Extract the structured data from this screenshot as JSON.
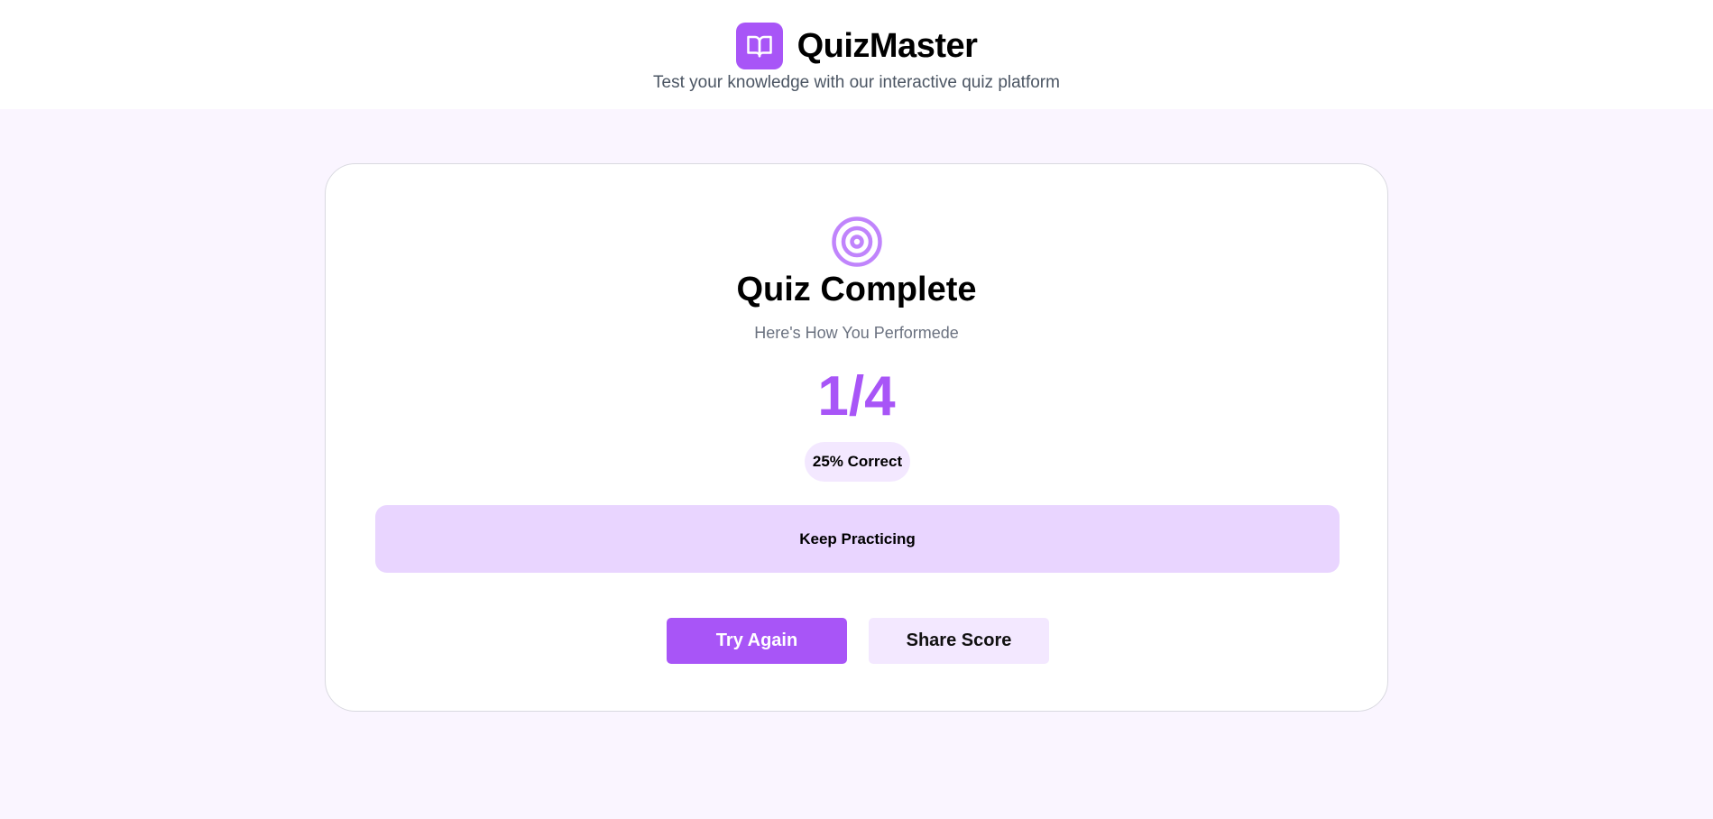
{
  "header": {
    "app_name": "QuizMaster",
    "logo_icon": "book-open-icon",
    "tagline": "Test your knowledge with our interactive quiz platform"
  },
  "result": {
    "icon": "target-icon",
    "title": "Quiz Complete",
    "subtitle": "Here's How You Performede",
    "score": "1/4",
    "correct_answers": 1,
    "total_questions": 4,
    "percentage_label": "25% Correct",
    "feedback": "Keep Practicing"
  },
  "actions": {
    "try_again_label": "Try Again",
    "share_score_label": "Share Score"
  },
  "colors": {
    "accent": "#a855f7",
    "accent_light": "#f3e8ff",
    "feedback_bg": "#e9d5ff",
    "page_bg": "#faf5ff"
  }
}
